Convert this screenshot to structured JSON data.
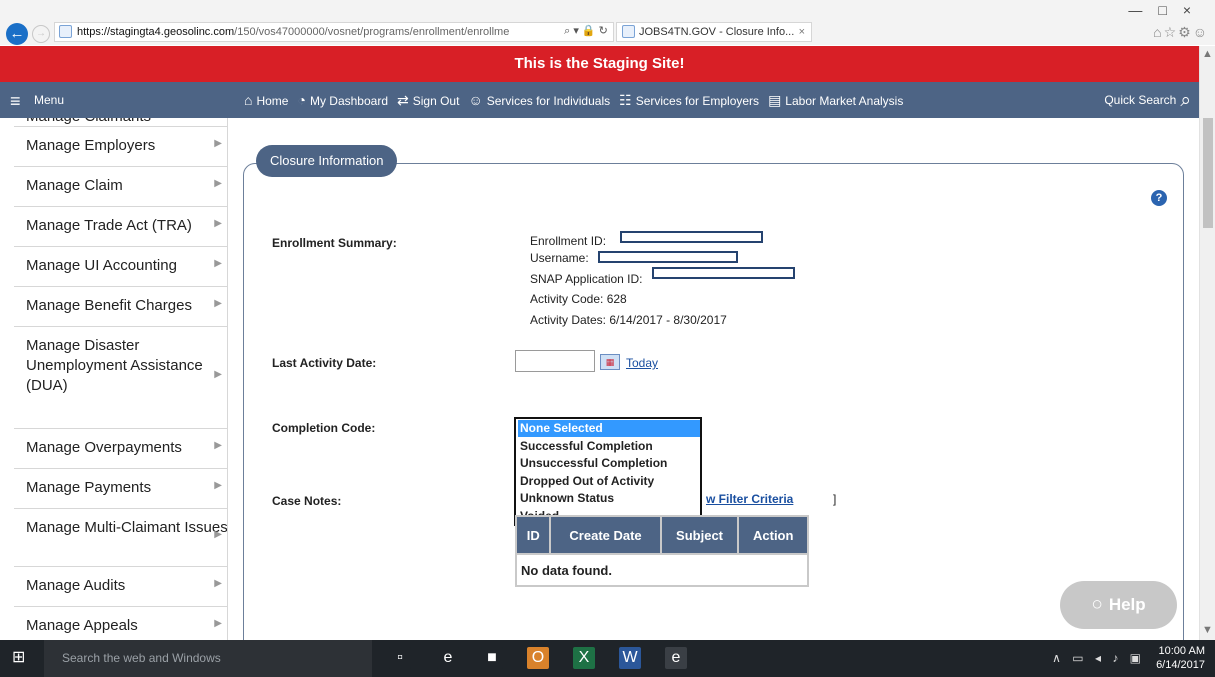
{
  "browser": {
    "url_host": "https://stagingta4.geosolinc.com",
    "url_path": "/150/vos47000000/vosnet/programs/enrollment/enrollme",
    "addr_tools": "⌕ ▾ 🔒 ↻",
    "tab_title": "JOBS4TN.GOV - Closure Info...",
    "tab_close": "×",
    "window_controls": "—□×",
    "chrome_icons": "⌂☆⚙☺",
    "back": "←",
    "forward": "→"
  },
  "banner": {
    "text": "This is the Staging Site!"
  },
  "nav": {
    "menu_icon": "≡",
    "menu_label": "Menu",
    "links": [
      {
        "icon": "⌂",
        "label": "Home"
      },
      {
        "icon": "◔",
        "label": "My Dashboard"
      },
      {
        "icon": "⇄",
        "label": "Sign Out"
      },
      {
        "icon": "☺",
        "label": "Services for Individuals"
      },
      {
        "icon": "☷",
        "label": "Services for Employers"
      },
      {
        "icon": "▤",
        "label": "Labor Market Analysis"
      }
    ],
    "quick_search_label": "Quick Search",
    "quick_search_icon": "⌕"
  },
  "sidebar": {
    "items": [
      {
        "label": "Manage Claimants"
      },
      {
        "label": "Manage Employers"
      },
      {
        "label": "Manage Claim"
      },
      {
        "label": "Manage Trade Act (TRA)"
      },
      {
        "label": "Manage UI Accounting"
      },
      {
        "label": "Manage Benefit Charges"
      },
      {
        "label": "Manage Disaster Unemployment Assistance (DUA)"
      },
      {
        "label": "Manage Overpayments"
      },
      {
        "label": "Manage Payments"
      },
      {
        "label": "Manage Multi-Claimant Issues"
      },
      {
        "label": "Manage Audits"
      },
      {
        "label": "Manage Appeals"
      }
    ],
    "arrow": "▶"
  },
  "main": {
    "legend": "Closure Information",
    "help_icon": "?",
    "enrollment_summary_label": "Enrollment Summary:",
    "summary": {
      "enrollment_id": "Enrollment ID:",
      "username": "Username:",
      "snap_app_id": "SNAP Application ID:",
      "activity_code": "Activity Code: 628",
      "activity_dates": "Activity Dates: 6/14/2017 - 8/30/2017"
    },
    "last_activity_date_label": "Last Activity Date:",
    "last_activity_date_value": "",
    "today_link": "Today",
    "completion_code_label": "Completion Code:",
    "completion_options": [
      "None Selected",
      "Successful Completion",
      "Unsuccessful Completion",
      "Dropped Out of Activity",
      "Unknown Status",
      "Voided"
    ],
    "completion_selected": "None Selected",
    "case_notes_label": "Case Notes:",
    "filter_link": "w Filter Criteria",
    "filter_bracket": "]",
    "table": {
      "headers": [
        "ID",
        "Create Date",
        "Subject",
        "Action"
      ],
      "empty_message": "No data found."
    },
    "help_bubble": "Help",
    "help_bubble_icon": "○"
  },
  "taskbar": {
    "start_icon": "⊞",
    "search_placeholder": "Search the web and Windows",
    "apps": [
      {
        "name": "task-view-icon",
        "glyph": "▫",
        "color": "#1f2429"
      },
      {
        "name": "edge-icon",
        "glyph": "e",
        "color": "#1f2429"
      },
      {
        "name": "file-explorer-icon",
        "glyph": "■",
        "color": "#1f2429"
      },
      {
        "name": "outlook-icon",
        "glyph": "O",
        "color": "#d9822b"
      },
      {
        "name": "excel-icon",
        "glyph": "X",
        "color": "#1e7145"
      },
      {
        "name": "word-icon",
        "glyph": "W",
        "color": "#2b579a"
      },
      {
        "name": "internet-explorer-icon",
        "glyph": "e",
        "color": "#3a3f45"
      }
    ],
    "tray": "∧ ▭ ◂ ♪ ▣",
    "time": "10:00 AM",
    "date": "6/14/2017"
  }
}
